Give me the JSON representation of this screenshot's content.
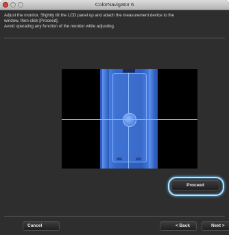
{
  "window": {
    "title": "ColorNavigator 6"
  },
  "instructions": {
    "lines": [
      "Adjust the monitor. Slightly tilt the LCD panel up and attach the measurement device to the",
      "window, then click [Proceed].",
      "Avoid operating any function of the monitor while adjusting."
    ]
  },
  "buttons": {
    "proceed": "Proceed",
    "cancel": "Cancel",
    "back": "< Back",
    "next": "Next >"
  },
  "colors": {
    "window_background": "#2e2e2e",
    "device_blue": "#3266c8",
    "guide_line": "#c9bf2a",
    "focus_ring": "#b7e5ff"
  },
  "icons": [
    "close-icon",
    "minimize-icon",
    "zoom-icon"
  ]
}
